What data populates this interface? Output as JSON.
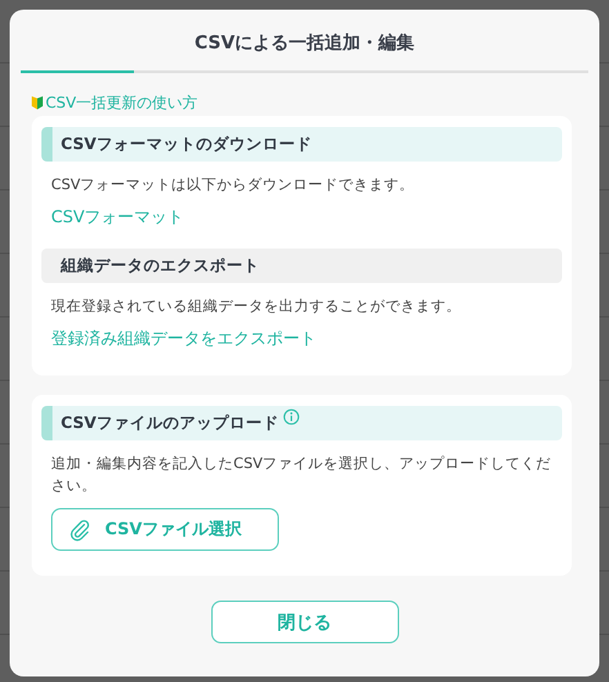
{
  "dialog": {
    "title": "CSVによる一括追加・編集",
    "help_link": "CSV一括更新の使い方"
  },
  "cards": [
    {
      "sections": [
        {
          "heading": "CSVフォーマットのダウンロード",
          "kind": "accent",
          "info": false,
          "description": "CSVフォーマットは以下からダウンロードできます。",
          "link": "CSVフォーマット"
        },
        {
          "heading": "組織データのエクスポート",
          "kind": "plain",
          "info": false,
          "description": "現在登録されている組織データを出力することができます。",
          "link": "登録済み組織データをエクスポート"
        }
      ]
    },
    {
      "sections": [
        {
          "heading": "CSVファイルのアップロード",
          "kind": "accent",
          "info": true,
          "description": "追加・編集内容を記入したCSVファイルを選択し、アップロードしてください。",
          "button": "CSVファイル選択"
        }
      ]
    }
  ],
  "buttons": [
    "閉じる"
  ]
}
